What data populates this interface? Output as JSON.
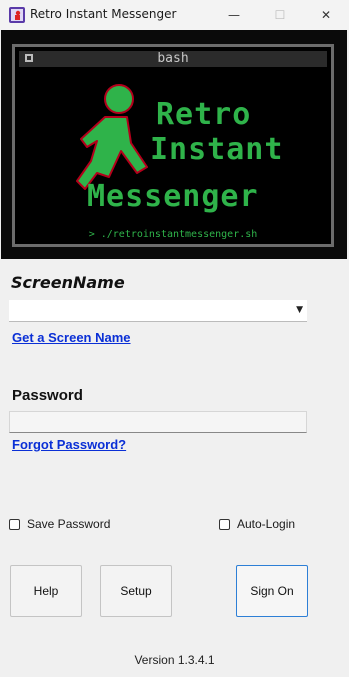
{
  "window": {
    "title": "Retro Instant Messenger",
    "minimize_glyph": "—",
    "maximize_glyph": "☐",
    "close_glyph": "✕"
  },
  "banner": {
    "terminal_title": "bash",
    "logo_line1": "Retro",
    "logo_line2": "Instant",
    "logo_line3": "Messenger",
    "command": "> ./retroinstantmessenger.sh",
    "logo_color": "#2fb34a",
    "runner_outline": "#b3001b"
  },
  "login": {
    "screenname_label": "ScreenName",
    "screenname_value": "",
    "get_screen_name_link": "Get a Screen Name",
    "password_label": "Password",
    "password_value": "",
    "forgot_password_link": "Forgot Password?",
    "save_password_label": "Save Password",
    "auto_login_label": "Auto-Login"
  },
  "buttons": {
    "help": "Help",
    "setup": "Setup",
    "sign_on": "Sign On"
  },
  "version": "Version 1.3.4.1",
  "icons": {
    "app": "app-logo-icon",
    "dropdown": "chevron-down-icon"
  }
}
